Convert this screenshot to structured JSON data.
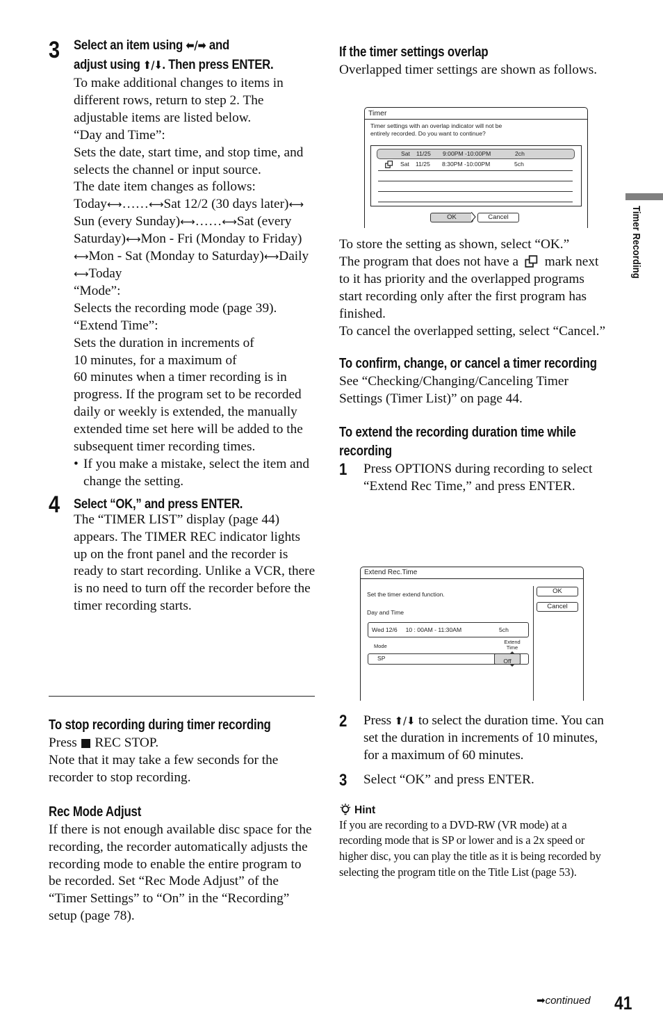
{
  "page": {
    "number": "41",
    "continued_label": "continued",
    "side_tab_label": "Timer Recording"
  },
  "left": {
    "step3": {
      "number": "3",
      "title_line1_pre": "Select an item using ",
      "title_line1_arrows": "⬅/➡",
      "title_line1_post": " and",
      "title_line2_pre": "adjust using ",
      "title_line2_arrows": "⬆/⬇",
      "title_line2_post": ". Then press ENTER.",
      "paragraphs": [
        "To make additional changes to items in different rows, return to step 2. The adjustable items are listed below.",
        "“Day and Time”:",
        "Sets the date, start time, and stop time, and selects the channel or input source.",
        "The date item changes as follows:"
      ],
      "date_sequence": [
        "Today",
        "……",
        "Sat 12/2 (30 days later)",
        "Sun (every Sunday)",
        "……",
        "Sat (every Saturday)",
        "Mon - Fri (Monday to Friday)",
        "Mon - Sat (Monday to Saturday)",
        "Daily",
        "Today"
      ],
      "mode_label": "“Mode”:",
      "mode_desc": "Selects the recording mode (page 39).",
      "extend_label": "“Extend Time”:",
      "extend_desc_1": "Sets the duration in increments of",
      "extend_desc_2": "10 minutes, for a maximum of",
      "extend_desc_3": "60 minutes when a timer recording is in progress. If the program set to be recorded daily or weekly is extended, the manually extended time set here will be added to the subsequent timer recording times.",
      "bullet": "If you make a mistake, select the item and change the setting."
    },
    "step4": {
      "number": "4",
      "title": "Select “OK,” and press ENTER.",
      "body": "The “TIMER LIST” display (page 44) appears. The TIMER REC indicator lights up on the front panel and the recorder is ready to start recording. Unlike a VCR, there is no need to turn off the recorder before the timer recording starts."
    },
    "stop_section": {
      "heading": "To stop recording during timer recording",
      "line1_pre": "Press ",
      "line1_icon": "■",
      "line1_post": " REC STOP.",
      "line2": "Note that it may take a few seconds for the recorder to stop recording."
    },
    "rec_mode_section": {
      "heading": "Rec Mode Adjust",
      "body": "If there is not enough available disc space for the recording, the recorder automatically adjusts the recording mode to enable the entire program to be recorded. Set “Rec Mode Adjust” of the “Timer Settings” to “On” in the “Recording” setup (page 78)."
    }
  },
  "right": {
    "overlap_section": {
      "heading": "If the timer settings overlap",
      "intro": "Overlapped timer settings are shown as follows.",
      "after_1": "To store the setting as shown, select “OK.”",
      "after_2_pre": "The program that does not have a",
      "after_2_post": "mark next to it has priority and the overlapped programs start recording only after the first program has finished.",
      "after_3": "To cancel the overlapped setting, select “Cancel.”"
    },
    "timer_screen": {
      "title": "Timer",
      "message_line1": "Timer settings with an overlap indicator will not be",
      "message_line2": "entirely recorded. Do you want to continue?",
      "rows": [
        {
          "overlap": false,
          "selected": true,
          "day": "Sat",
          "date": "11/25",
          "time": "9:00PM -10:00PM",
          "channel": "2ch"
        },
        {
          "overlap": true,
          "selected": false,
          "day": "Sat",
          "date": "11/25",
          "time": "8:30PM -10:00PM",
          "channel": "5ch"
        }
      ],
      "ok_label": "OK",
      "cancel_label": "Cancel"
    },
    "confirm_section": {
      "heading": "To confirm, change, or cancel a timer recording",
      "body": "See “Checking/Changing/Canceling Timer Settings (Timer List)” on page 44."
    },
    "extend_section": {
      "heading": "To extend the recording duration time while recording",
      "step1_num": "1",
      "step1": "Press OPTIONS during recording to select “Extend Rec Time,” and press ENTER.",
      "step2_num": "2",
      "step2_pre": "Press ",
      "step2_arrows": "⬆/⬇",
      "step2_post": " to select the duration time. You can set the duration in increments of 10 minutes, for a maximum of 60 minutes.",
      "step3_num": "3",
      "step3": "Select “OK” and press ENTER."
    },
    "extend_screen": {
      "title": "Extend Rec.Time",
      "message": "Set the timer extend function.",
      "day_time_label": "Day and Time",
      "day_time_value": "Wed 12/6     10 : 00AM - 11:30AM",
      "channel": "5ch",
      "mode_label": "Mode",
      "extend_label_1": "Extend",
      "extend_label_2": "Time",
      "mode_value": "SP",
      "extend_value": "Off",
      "ok_label": "OK",
      "cancel_label": "Cancel"
    },
    "hint": {
      "label": "Hint",
      "body": "If you are recording to a DVD-RW (VR mode) at a recording mode that is SP or lower and is a 2x speed or higher disc, you can play the title as it is being recorded by selecting the program title on the Title List (page 53)."
    }
  }
}
